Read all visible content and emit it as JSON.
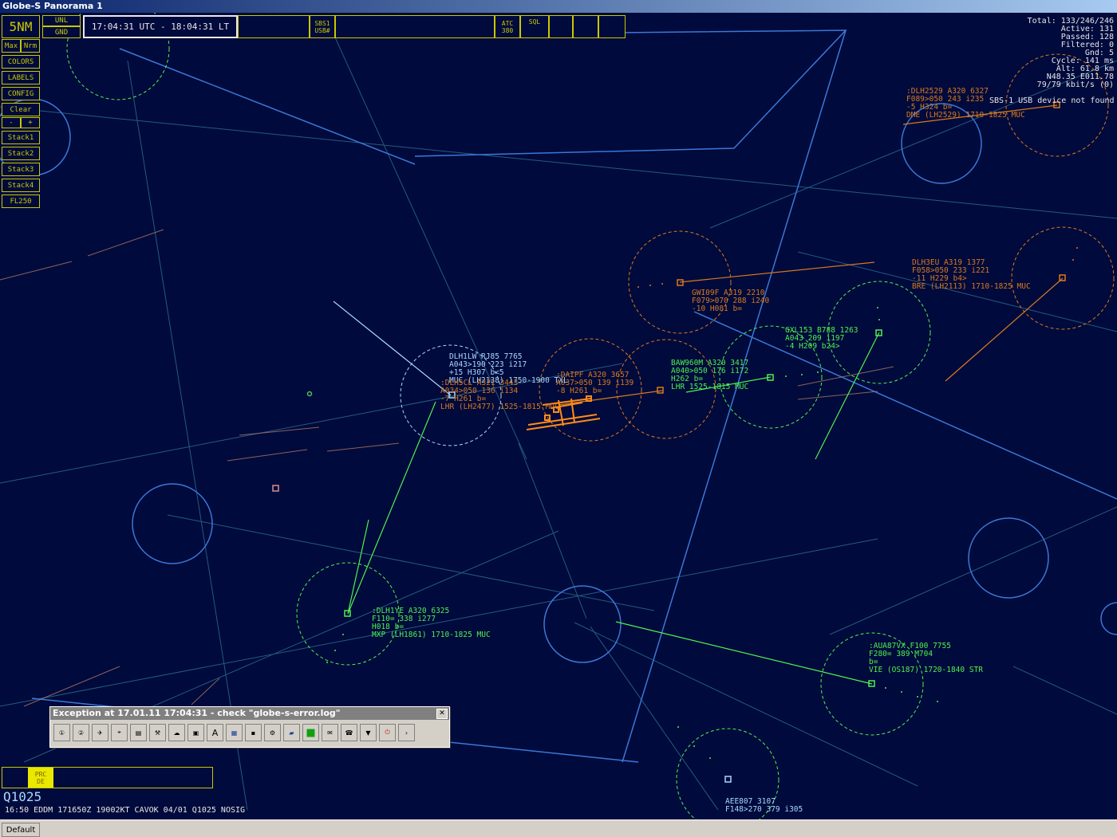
{
  "window": {
    "title": "Globe-S Panorama 1"
  },
  "toolbar": {
    "range": "5NM",
    "unl": "UNL",
    "gnd": "GND",
    "clock": "17:04:31 UTC - 18:04:31 LT",
    "sbs1": "SBS1",
    "usb": "USB#",
    "atc": "ATC",
    "atc_freq": "380",
    "sql": "SQL"
  },
  "side_buttons": {
    "max": "Max",
    "nrm": "Nrm",
    "colors": "COLORS",
    "labels": "LABELS",
    "config": "CONFIG",
    "clear": "Clear",
    "minus": "-",
    "plus": "+",
    "stack1": "Stack1",
    "stack2": "Stack2",
    "stack3": "Stack3",
    "stack4": "Stack4",
    "fl": "FL250"
  },
  "stats": {
    "total": "Total: 133/246/246",
    "active": "Active: 131",
    "passed": "Passed: 128",
    "filtered": "Filtered: 0",
    "gnd": "Gnd: 5",
    "cycle": "Cycle: 141 ms",
    "alt": "Alt:  61.8 km",
    "pos": "N48.35 E011.78",
    "rate": "79/79 kbit/s (0)",
    "device": "SBS-1 USB device not found"
  },
  "aircraft": [
    {
      "c": "orange",
      "lines": [
        ":DLH2529 A320 6327",
        "F089>050 243 i235",
        "-5 H324 b=",
        "DME (LH2529) 1710-1825 MUC"
      ]
    },
    {
      "c": "orange",
      "lines": [
        "DLH3EU A319 1377",
        "F058>050 233 i221",
        "-11 H229 b4>",
        "BRE (LH2113) 1710-1825 MUC"
      ]
    },
    {
      "c": "orange",
      "lines": [
        "GWI09F A319 2210",
        "F079>070 288 i240",
        "-10 H081 b="
      ]
    },
    {
      "c": "green",
      "lines": [
        "GXL153 B788 1263",
        "A043 209 i197",
        "-4 H209 b24>"
      ]
    },
    {
      "c": "green",
      "lines": [
        "BAW960M A320 3417",
        "A040>050 176 i172",
        "H262 b=",
        "LHR 1525-1815 MUC"
      ]
    },
    {
      "c": "orange",
      "lines": [
        ":DAIPF A320 3657",
        "A037>050 139 i139",
        "-8 H261 b="
      ]
    },
    {
      "c": "cyan",
      "lines": [
        "DLH1LW RJ85 7765",
        "A043>190 223 i217",
        "+15 H307 b<5",
        "MUC (LH2138) 1750-1900 TXL"
      ]
    },
    {
      "c": "orange",
      "lines": [
        ":DLH5CL A321 3443",
        "A034>050 136 i134",
        "-7 H261 b=",
        "LHR (LH2477) 1525-1815 MUC"
      ]
    },
    {
      "c": "green",
      "lines": [
        ":DLH1YE A320 6325",
        "F110= 338 i277",
        "H018 b=",
        "MXP (LH1861) 1710-1825 MUC"
      ]
    },
    {
      "c": "green",
      "lines": [
        ":AUA87VX F100 7755",
        "F280= 389 M704",
        "b=",
        "VIE (OS187) 1720-1840 STR"
      ]
    },
    {
      "c": "cyan",
      "lines": [
        "AEE807 3107",
        "F148>270 379 i305"
      ]
    }
  ],
  "exception": {
    "title": "Exception at 17.01.11 17:04:31 - check \"globe-s-error.log\""
  },
  "metar": {
    "qnh": "Q1025",
    "line": "16:50  EDDM  171650Z  19002KT  CAVOK  04/01  Q1025  NOSIG",
    "prc": "PRC",
    "de": "DE"
  },
  "statusbar": {
    "default": "Default"
  },
  "colors": {
    "orange": "#d87a1e",
    "green": "#50f050",
    "cyan": "#a8d8ff",
    "yellow": "#c8c800",
    "background": "#000a3c"
  }
}
